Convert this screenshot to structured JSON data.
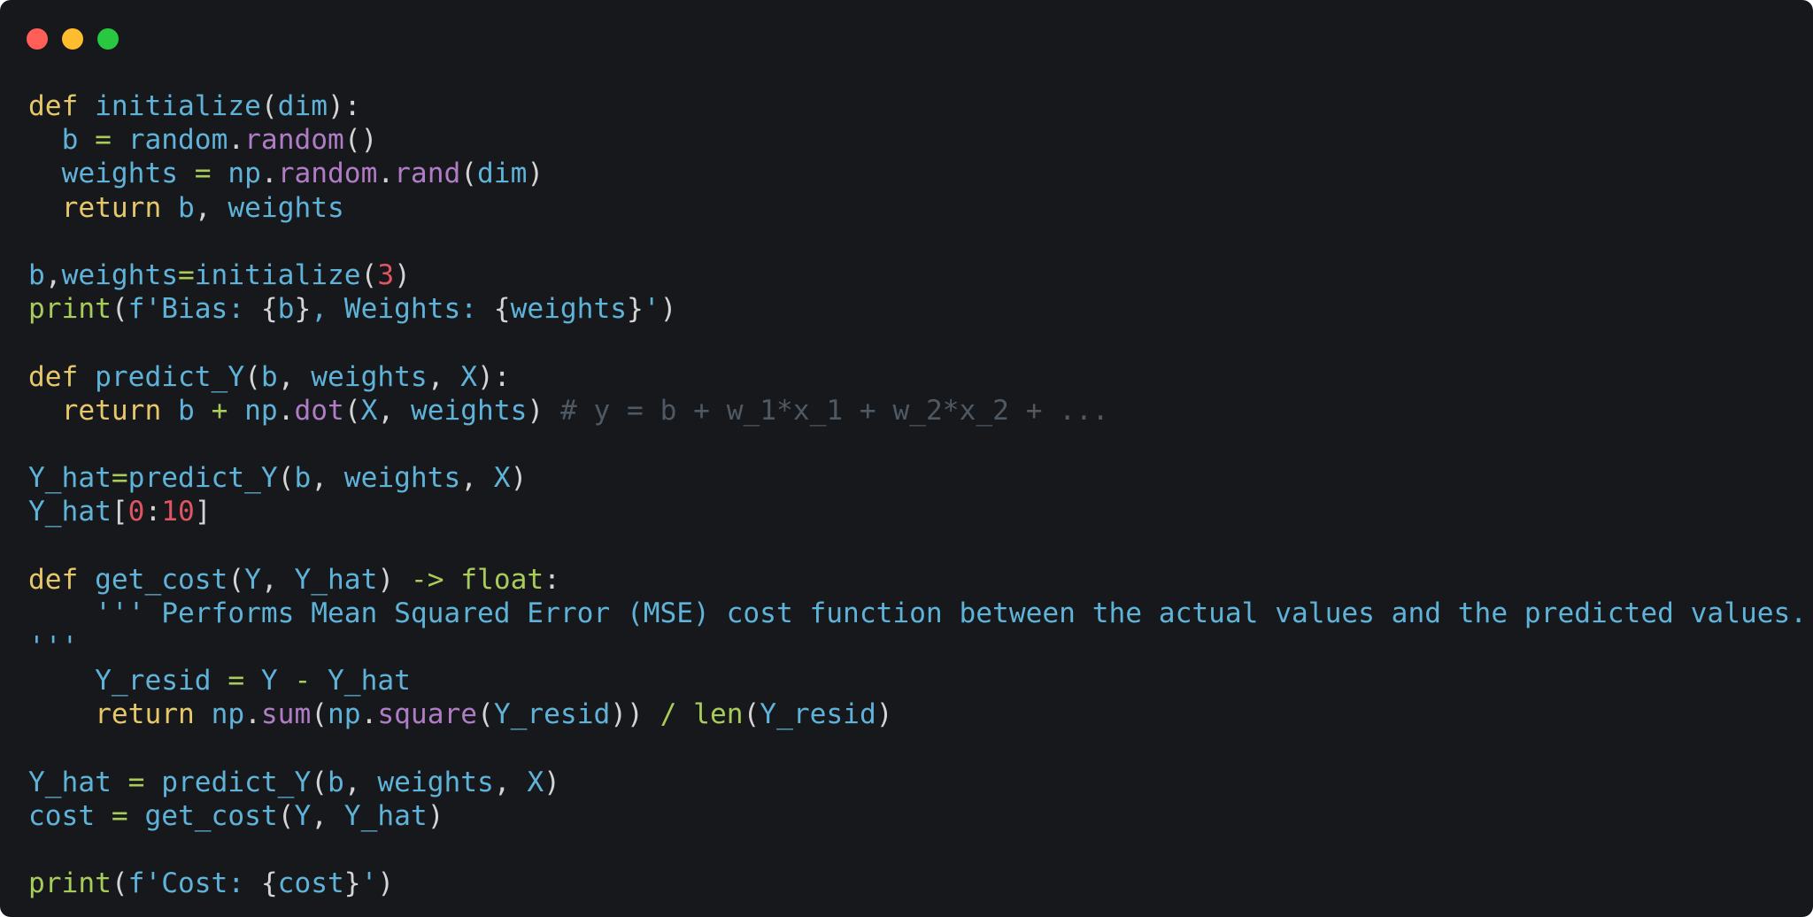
{
  "window": {
    "controls": [
      {
        "name": "close",
        "color": "#ff5f57"
      },
      {
        "name": "minimize",
        "color": "#febc2e"
      },
      {
        "name": "maximize",
        "color": "#28c840"
      }
    ]
  },
  "colors": {
    "background": "#16181c",
    "keyword": "#e6c76a",
    "identifier": "#5fb3d9",
    "attribute": "#b07cc6",
    "operator": "#a8cc5a",
    "number": "#e05561",
    "comment": "#4f5963",
    "punctuation": "#d4d4d4"
  },
  "code": {
    "language": "python",
    "lines": [
      [
        {
          "t": "kw",
          "v": "def"
        },
        {
          "t": "punc",
          "v": " "
        },
        {
          "t": "fn",
          "v": "initialize"
        },
        {
          "t": "punc",
          "v": "("
        },
        {
          "t": "id",
          "v": "dim"
        },
        {
          "t": "punc",
          "v": "):"
        }
      ],
      [
        {
          "t": "punc",
          "v": "  "
        },
        {
          "t": "id",
          "v": "b"
        },
        {
          "t": "punc",
          "v": " "
        },
        {
          "t": "op",
          "v": "="
        },
        {
          "t": "punc",
          "v": " "
        },
        {
          "t": "id",
          "v": "random"
        },
        {
          "t": "punc",
          "v": "."
        },
        {
          "t": "attr",
          "v": "random"
        },
        {
          "t": "punc",
          "v": "()"
        }
      ],
      [
        {
          "t": "punc",
          "v": "  "
        },
        {
          "t": "id",
          "v": "weights"
        },
        {
          "t": "punc",
          "v": " "
        },
        {
          "t": "op",
          "v": "="
        },
        {
          "t": "punc",
          "v": " "
        },
        {
          "t": "id",
          "v": "np"
        },
        {
          "t": "punc",
          "v": "."
        },
        {
          "t": "attr",
          "v": "random"
        },
        {
          "t": "punc",
          "v": "."
        },
        {
          "t": "attr",
          "v": "rand"
        },
        {
          "t": "punc",
          "v": "("
        },
        {
          "t": "id",
          "v": "dim"
        },
        {
          "t": "punc",
          "v": ")"
        }
      ],
      [
        {
          "t": "punc",
          "v": "  "
        },
        {
          "t": "kw",
          "v": "return"
        },
        {
          "t": "punc",
          "v": " "
        },
        {
          "t": "id",
          "v": "b"
        },
        {
          "t": "punc",
          "v": ", "
        },
        {
          "t": "id",
          "v": "weights"
        }
      ],
      [],
      [
        {
          "t": "id",
          "v": "b"
        },
        {
          "t": "punc",
          "v": ","
        },
        {
          "t": "id",
          "v": "weights"
        },
        {
          "t": "op",
          "v": "="
        },
        {
          "t": "fn",
          "v": "initialize"
        },
        {
          "t": "punc",
          "v": "("
        },
        {
          "t": "num",
          "v": "3"
        },
        {
          "t": "punc",
          "v": ")"
        }
      ],
      [
        {
          "t": "builtin",
          "v": "print"
        },
        {
          "t": "punc",
          "v": "("
        },
        {
          "t": "str",
          "v": "f'Bias: "
        },
        {
          "t": "punc",
          "v": "{"
        },
        {
          "t": "id",
          "v": "b"
        },
        {
          "t": "punc",
          "v": "}"
        },
        {
          "t": "str",
          "v": ", Weights: "
        },
        {
          "t": "punc",
          "v": "{"
        },
        {
          "t": "id",
          "v": "weights"
        },
        {
          "t": "punc",
          "v": "}"
        },
        {
          "t": "str",
          "v": "'"
        },
        {
          "t": "punc",
          "v": ")"
        }
      ],
      [],
      [
        {
          "t": "kw",
          "v": "def"
        },
        {
          "t": "punc",
          "v": " "
        },
        {
          "t": "fn",
          "v": "predict_Y"
        },
        {
          "t": "punc",
          "v": "("
        },
        {
          "t": "id",
          "v": "b"
        },
        {
          "t": "punc",
          "v": ", "
        },
        {
          "t": "id",
          "v": "weights"
        },
        {
          "t": "punc",
          "v": ", "
        },
        {
          "t": "id",
          "v": "X"
        },
        {
          "t": "punc",
          "v": "):"
        }
      ],
      [
        {
          "t": "punc",
          "v": "  "
        },
        {
          "t": "kw",
          "v": "return"
        },
        {
          "t": "punc",
          "v": " "
        },
        {
          "t": "id",
          "v": "b"
        },
        {
          "t": "punc",
          "v": " "
        },
        {
          "t": "op",
          "v": "+"
        },
        {
          "t": "punc",
          "v": " "
        },
        {
          "t": "id",
          "v": "np"
        },
        {
          "t": "punc",
          "v": "."
        },
        {
          "t": "attr",
          "v": "dot"
        },
        {
          "t": "punc",
          "v": "("
        },
        {
          "t": "id",
          "v": "X"
        },
        {
          "t": "punc",
          "v": ", "
        },
        {
          "t": "id",
          "v": "weights"
        },
        {
          "t": "punc",
          "v": ") "
        },
        {
          "t": "comment",
          "v": "# y = b + w_1*x_1 + w_2*x_2 + ..."
        }
      ],
      [],
      [
        {
          "t": "id",
          "v": "Y_hat"
        },
        {
          "t": "op",
          "v": "="
        },
        {
          "t": "fn",
          "v": "predict_Y"
        },
        {
          "t": "punc",
          "v": "("
        },
        {
          "t": "id",
          "v": "b"
        },
        {
          "t": "punc",
          "v": ", "
        },
        {
          "t": "id",
          "v": "weights"
        },
        {
          "t": "punc",
          "v": ", "
        },
        {
          "t": "id",
          "v": "X"
        },
        {
          "t": "punc",
          "v": ")"
        }
      ],
      [
        {
          "t": "id",
          "v": "Y_hat"
        },
        {
          "t": "punc",
          "v": "["
        },
        {
          "t": "num",
          "v": "0"
        },
        {
          "t": "punc",
          "v": ":"
        },
        {
          "t": "num",
          "v": "10"
        },
        {
          "t": "punc",
          "v": "]"
        }
      ],
      [],
      [
        {
          "t": "kw",
          "v": "def"
        },
        {
          "t": "punc",
          "v": " "
        },
        {
          "t": "fn",
          "v": "get_cost"
        },
        {
          "t": "punc",
          "v": "("
        },
        {
          "t": "id",
          "v": "Y"
        },
        {
          "t": "punc",
          "v": ", "
        },
        {
          "t": "id",
          "v": "Y_hat"
        },
        {
          "t": "punc",
          "v": ") "
        },
        {
          "t": "op",
          "v": "->"
        },
        {
          "t": "punc",
          "v": " "
        },
        {
          "t": "builtin",
          "v": "float"
        },
        {
          "t": "punc",
          "v": ":"
        }
      ],
      [
        {
          "t": "punc",
          "v": "    "
        },
        {
          "t": "str",
          "v": "''' Performs Mean Squared Error (MSE) cost function between the actual values and the predicted values."
        }
      ],
      [
        {
          "t": "str",
          "v": "'''"
        }
      ],
      [
        {
          "t": "punc",
          "v": "    "
        },
        {
          "t": "id",
          "v": "Y_resid"
        },
        {
          "t": "punc",
          "v": " "
        },
        {
          "t": "op",
          "v": "="
        },
        {
          "t": "punc",
          "v": " "
        },
        {
          "t": "id",
          "v": "Y"
        },
        {
          "t": "punc",
          "v": " "
        },
        {
          "t": "op",
          "v": "-"
        },
        {
          "t": "punc",
          "v": " "
        },
        {
          "t": "id",
          "v": "Y_hat"
        }
      ],
      [
        {
          "t": "punc",
          "v": "    "
        },
        {
          "t": "kw",
          "v": "return"
        },
        {
          "t": "punc",
          "v": " "
        },
        {
          "t": "id",
          "v": "np"
        },
        {
          "t": "punc",
          "v": "."
        },
        {
          "t": "attr",
          "v": "sum"
        },
        {
          "t": "punc",
          "v": "("
        },
        {
          "t": "id",
          "v": "np"
        },
        {
          "t": "punc",
          "v": "."
        },
        {
          "t": "attr",
          "v": "square"
        },
        {
          "t": "punc",
          "v": "("
        },
        {
          "t": "id",
          "v": "Y_resid"
        },
        {
          "t": "punc",
          "v": ")) "
        },
        {
          "t": "op",
          "v": "/"
        },
        {
          "t": "punc",
          "v": " "
        },
        {
          "t": "builtin",
          "v": "len"
        },
        {
          "t": "punc",
          "v": "("
        },
        {
          "t": "id",
          "v": "Y_resid"
        },
        {
          "t": "punc",
          "v": ")"
        }
      ],
      [],
      [
        {
          "t": "id",
          "v": "Y_hat"
        },
        {
          "t": "punc",
          "v": " "
        },
        {
          "t": "op",
          "v": "="
        },
        {
          "t": "punc",
          "v": " "
        },
        {
          "t": "fn",
          "v": "predict_Y"
        },
        {
          "t": "punc",
          "v": "("
        },
        {
          "t": "id",
          "v": "b"
        },
        {
          "t": "punc",
          "v": ", "
        },
        {
          "t": "id",
          "v": "weights"
        },
        {
          "t": "punc",
          "v": ", "
        },
        {
          "t": "id",
          "v": "X"
        },
        {
          "t": "punc",
          "v": ")"
        }
      ],
      [
        {
          "t": "id",
          "v": "cost"
        },
        {
          "t": "punc",
          "v": " "
        },
        {
          "t": "op",
          "v": "="
        },
        {
          "t": "punc",
          "v": " "
        },
        {
          "t": "fn",
          "v": "get_cost"
        },
        {
          "t": "punc",
          "v": "("
        },
        {
          "t": "id",
          "v": "Y"
        },
        {
          "t": "punc",
          "v": ", "
        },
        {
          "t": "id",
          "v": "Y_hat"
        },
        {
          "t": "punc",
          "v": ")"
        }
      ],
      [],
      [
        {
          "t": "builtin",
          "v": "print"
        },
        {
          "t": "punc",
          "v": "("
        },
        {
          "t": "str",
          "v": "f'Cost: "
        },
        {
          "t": "punc",
          "v": "{"
        },
        {
          "t": "id",
          "v": "cost"
        },
        {
          "t": "punc",
          "v": "}"
        },
        {
          "t": "str",
          "v": "'"
        },
        {
          "t": "punc",
          "v": ")"
        }
      ]
    ]
  }
}
